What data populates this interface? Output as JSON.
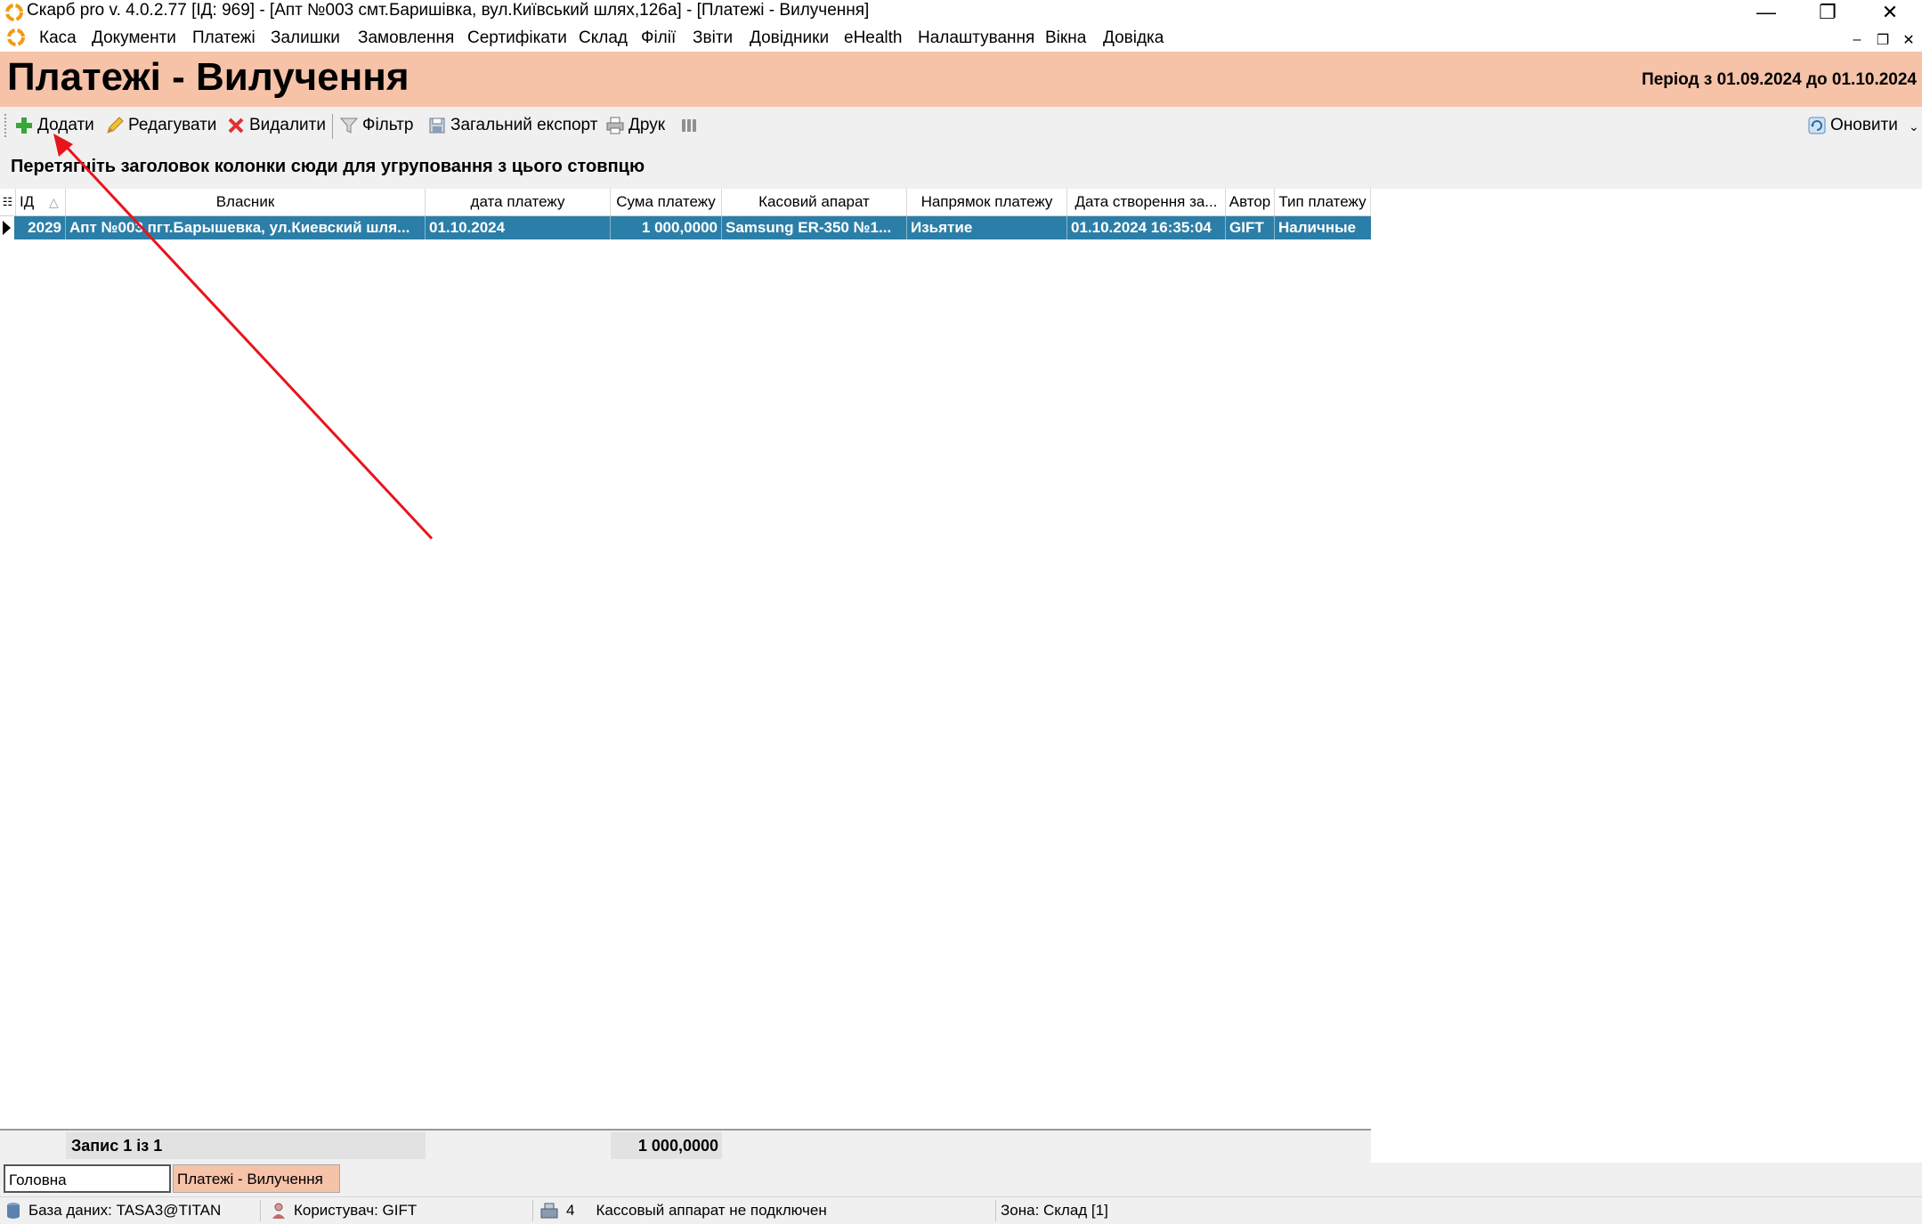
{
  "window": {
    "title": "Скарб pro v. 4.0.2.77 [ІД: 969] - [Апт №003 смт.Баришівка, вул.Київський шлях,126а] - [Платежі - Вилучення]",
    "minimize": "—",
    "restore": "❐",
    "close": "✕"
  },
  "menu": {
    "items": [
      "Каса",
      "Документи",
      "Платежі",
      "Залишки",
      "Замовлення",
      "Сертифікати",
      "Склад",
      "Філії",
      "Звіти",
      "Довідники",
      "eHealth",
      "Налаштування",
      "Вікна",
      "Довідка"
    ],
    "mdi_min": "–",
    "mdi_restore": "❐",
    "mdi_close": "✕"
  },
  "header": {
    "title": "Платежі - Вилучення",
    "period": "Період з 01.09.2024 до 01.10.2024"
  },
  "toolbar": {
    "add": "Додати",
    "edit": "Редагувати",
    "delete": "Видалити",
    "filter": "Фільтр",
    "export": "Загальний експорт",
    "print": "Друк",
    "refresh": "Оновити"
  },
  "group_hint": "Перетягніть заголовок колонки сюди для угруповання з цього стовпцю",
  "grid": {
    "columns": [
      "ІД",
      "Власник",
      "дата платежу",
      "Сума платежу",
      "Касовий апарат",
      "Напрямок платежу",
      "Дата створення за...",
      "Автор",
      "Тип платежу"
    ],
    "rows": [
      [
        "2029",
        "Апт №003 пгт.Барышевка, ул.Киевский шля...",
        "01.10.2024",
        "1 000,0000",
        "Samsung ER-350 №1...",
        "Изьятие",
        "01.10.2024 16:35:04",
        "GIFT",
        "Наличные"
      ]
    ]
  },
  "footer": {
    "record_count": "Запис 1 із 1",
    "sum_total": "1 000,0000"
  },
  "tabs": [
    "Головна",
    "Платежі - Вилучення"
  ],
  "status": {
    "database": "База даних: TASA3@TITAN",
    "user": "Користувач: GIFT",
    "count": "4",
    "cash_register": "Кассовый аппарат не подключен",
    "zone": "Зона: Склад [1]"
  },
  "colors": {
    "header_bg": "#f6c2a8",
    "selected_row": "#2b7ea7",
    "active_tab": "#f6c2a8",
    "annotation_arrow": "#e8141c"
  }
}
